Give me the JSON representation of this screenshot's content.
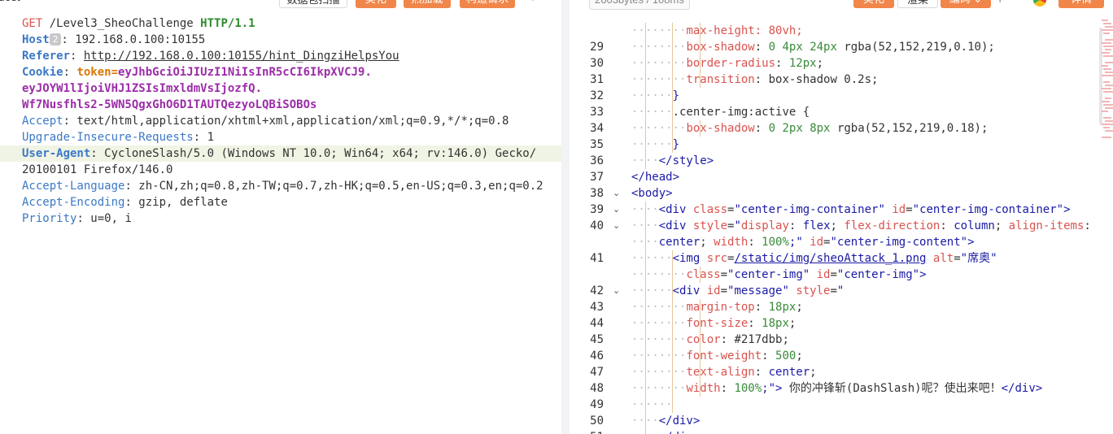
{
  "left": {
    "title": "uest",
    "nav_back": "‹",
    "nav_forward": "›",
    "buttons": [
      "数据包扫描",
      "美化",
      "热加载",
      "构造请求"
    ],
    "expand_icon": "expand-icon",
    "request_lines": [
      [
        {
          "t": "GET",
          "c": "k-method"
        },
        {
          "t": " /Level3_SheoChallenge ",
          "c": "k-path"
        },
        {
          "t": "HTTP/1.1",
          "c": "k-proto"
        }
      ],
      [
        {
          "t": "Host",
          "c": "k-hdr bold"
        },
        {
          "t": "2",
          "c": "badge"
        },
        {
          "t": ": 192.168.0.100:10155",
          "c": "k-val"
        }
      ],
      [
        {
          "t": "Referer",
          "c": "k-hdr bold"
        },
        {
          "t": ": ",
          "c": "k-val"
        },
        {
          "t": "http://192.168.0.100:10155/hint_DingziHelpsYou",
          "c": "k-link"
        }
      ],
      [
        {
          "t": "Cookie",
          "c": "k-hdr bold"
        },
        {
          "t": ": ",
          "c": "k-val"
        },
        {
          "t": "token=",
          "c": "k-token-name"
        },
        {
          "t": "eyJhbGciOiJIUzI1NiIsInR5cCI6IkpXVCJ9.",
          "c": "k-token"
        }
      ],
      [
        {
          "t": "eyJOYW1lIjoiVHJ1ZSIsImxldmVsIjozfQ.",
          "c": "k-token"
        }
      ],
      [
        {
          "t": "Wf7Nusfhls2-5WN5QgxGhO6D1TAUTQezyoLQBiSOBOs",
          "c": "k-token"
        }
      ],
      [
        {
          "t": "Accept",
          "c": "k-hdr"
        },
        {
          "t": ": text/html,application/xhtml+xml,application/xml;q=0.9,*/*;q=0.8",
          "c": "k-val"
        }
      ],
      [
        {
          "t": "Upgrade-Insecure-Requests",
          "c": "k-hdr"
        },
        {
          "t": ": 1",
          "c": "k-val"
        }
      ],
      [
        {
          "t": "User-Agent",
          "c": "k-hdr bold"
        },
        {
          "t": ": CycloneSlash/5.0 (Windows NT 10.0; Win64; x64; rv:146.0) Gecko/",
          "c": "k-val"
        }
      ],
      [
        {
          "t": "20100101 Firefox/146.0",
          "c": "k-val"
        }
      ],
      [
        {
          "t": "Accept-Language",
          "c": "k-hdr"
        },
        {
          "t": ": zh-CN,zh;q=0.8,zh-TW;q=0.7,zh-HK;q=0.5,en-US;q=0.3,en;q=0.2",
          "c": "k-val"
        }
      ],
      [
        {
          "t": "Accept-Encoding",
          "c": "k-hdr"
        },
        {
          "t": ": gzip, deflate",
          "c": "k-val"
        }
      ],
      [
        {
          "t": "Priority",
          "c": "k-hdr"
        },
        {
          "t": ": u=0, i",
          "c": "k-val"
        }
      ]
    ],
    "highlight_line": 8
  },
  "right": {
    "size_info": "2603bytes / 108ms",
    "buttons": [
      "美化",
      "渲染",
      "编码 ⌄",
      "详情"
    ],
    "search_icon": "search-icon",
    "code_lines": [
      {
        "n": "",
        "fold": "",
        "indent": 4,
        "tokens": [
          {
            "t": "max-height: 80vh;",
            "c": "c-prop"
          }
        ]
      },
      {
        "n": "29",
        "fold": "",
        "indent": 4,
        "tokens": [
          {
            "t": "box-shadow",
            "c": "c-prop"
          },
          {
            "t": ": ",
            "c": "c-txt"
          },
          {
            "t": "0",
            "c": "c-num"
          },
          {
            "t": " ",
            "c": "c-txt"
          },
          {
            "t": "4px",
            "c": "c-num"
          },
          {
            "t": " ",
            "c": "c-txt"
          },
          {
            "t": "24px",
            "c": "c-num"
          },
          {
            "t": " ",
            "c": "c-txt"
          },
          {
            "t": "rgba",
            "c": "c-txt"
          },
          {
            "t": "(52,152,219,0.10);",
            "c": "c-txt"
          }
        ]
      },
      {
        "n": "30",
        "fold": "",
        "indent": 4,
        "tokens": [
          {
            "t": "border-radius",
            "c": "c-prop"
          },
          {
            "t": ": ",
            "c": "c-txt"
          },
          {
            "t": "12px",
            "c": "c-num"
          },
          {
            "t": ";",
            "c": "c-txt"
          }
        ]
      },
      {
        "n": "31",
        "fold": "",
        "indent": 4,
        "tokens": [
          {
            "t": "transition",
            "c": "c-prop"
          },
          {
            "t": ": box-shadow 0.2s;",
            "c": "c-txt"
          }
        ]
      },
      {
        "n": "32",
        "fold": "",
        "indent": 3,
        "tokens": [
          {
            "t": "}",
            "c": "c-tag"
          }
        ]
      },
      {
        "n": "33",
        "fold": "",
        "indent": 3,
        "tokens": [
          {
            "t": ".center-img:active {",
            "c": "c-txt"
          }
        ]
      },
      {
        "n": "34",
        "fold": "",
        "indent": 4,
        "tokens": [
          {
            "t": "box-shadow",
            "c": "c-prop"
          },
          {
            "t": ": ",
            "c": "c-txt"
          },
          {
            "t": "0",
            "c": "c-num"
          },
          {
            "t": " ",
            "c": "c-txt"
          },
          {
            "t": "2px",
            "c": "c-num"
          },
          {
            "t": " ",
            "c": "c-txt"
          },
          {
            "t": "8px",
            "c": "c-num"
          },
          {
            "t": " ",
            "c": "c-txt"
          },
          {
            "t": "rgba",
            "c": "c-txt"
          },
          {
            "t": "(52,152,219,0.18);",
            "c": "c-txt"
          }
        ]
      },
      {
        "n": "35",
        "fold": "",
        "indent": 3,
        "tokens": [
          {
            "t": "}",
            "c": "c-tag"
          }
        ]
      },
      {
        "n": "36",
        "fold": "",
        "indent": 2,
        "tokens": [
          {
            "t": "</style>",
            "c": "c-tag"
          }
        ]
      },
      {
        "n": "37",
        "fold": "",
        "indent": 0,
        "tokens": [
          {
            "t": "</head>",
            "c": "c-tag"
          }
        ]
      },
      {
        "n": "38",
        "fold": "⌄",
        "indent": 0,
        "tokens": [
          {
            "t": "<body>",
            "c": "c-tag"
          }
        ]
      },
      {
        "n": "39",
        "fold": "⌄",
        "indent": 2,
        "tokens": [
          {
            "t": "<div ",
            "c": "c-tag"
          },
          {
            "t": "class",
            "c": "c-attr"
          },
          {
            "t": "=",
            "c": "c-txt"
          },
          {
            "t": "\"center-img-container\"",
            "c": "c-str"
          },
          {
            "t": " ",
            "c": "c-txt"
          },
          {
            "t": "id",
            "c": "c-attr"
          },
          {
            "t": "=",
            "c": "c-txt"
          },
          {
            "t": "\"center-img-container\"",
            "c": "c-str"
          },
          {
            "t": ">",
            "c": "c-tag"
          }
        ]
      },
      {
        "n": "40",
        "fold": "⌄",
        "indent": 2,
        "tokens": [
          {
            "t": "<div ",
            "c": "c-tag"
          },
          {
            "t": "style",
            "c": "c-attr"
          },
          {
            "t": "=",
            "c": "c-txt"
          },
          {
            "t": "\"",
            "c": "c-str"
          },
          {
            "t": "display",
            "c": "c-prop"
          },
          {
            "t": ": ",
            "c": "c-txt"
          },
          {
            "t": "flex",
            "c": "c-str"
          },
          {
            "t": "; ",
            "c": "c-txt"
          },
          {
            "t": "flex-direction",
            "c": "c-prop"
          },
          {
            "t": ": ",
            "c": "c-txt"
          },
          {
            "t": "column",
            "c": "c-str"
          },
          {
            "t": "; ",
            "c": "c-txt"
          },
          {
            "t": "align-items",
            "c": "c-prop"
          },
          {
            "t": ":",
            "c": "c-txt"
          }
        ]
      },
      {
        "n": "",
        "fold": "",
        "indent": 2,
        "tokens": [
          {
            "t": "center",
            "c": "c-str"
          },
          {
            "t": "; ",
            "c": "c-txt"
          },
          {
            "t": "width",
            "c": "c-prop"
          },
          {
            "t": ": ",
            "c": "c-txt"
          },
          {
            "t": "100%",
            "c": "c-num"
          },
          {
            "t": ";\"",
            "c": "c-str"
          },
          {
            "t": " ",
            "c": "c-txt"
          },
          {
            "t": "id",
            "c": "c-attr"
          },
          {
            "t": "=",
            "c": "c-txt"
          },
          {
            "t": "\"center-img-content\"",
            "c": "c-str"
          },
          {
            "t": ">",
            "c": "c-tag"
          }
        ]
      },
      {
        "n": "41",
        "fold": "",
        "indent": 3,
        "tokens": [
          {
            "t": "<img ",
            "c": "c-tag"
          },
          {
            "t": "src",
            "c": "c-attr"
          },
          {
            "t": "=",
            "c": "c-txt"
          },
          {
            "t": "/static/img/sheoAttack_1.png",
            "c": "c-link"
          },
          {
            "t": " ",
            "c": "c-txt"
          },
          {
            "t": "alt",
            "c": "c-attr"
          },
          {
            "t": "=",
            "c": "c-txt"
          },
          {
            "t": "\"席奥\"",
            "c": "c-str"
          }
        ]
      },
      {
        "n": "",
        "fold": "",
        "indent": 4,
        "tokens": [
          {
            "t": "class",
            "c": "c-attr"
          },
          {
            "t": "=",
            "c": "c-txt"
          },
          {
            "t": "\"center-img\"",
            "c": "c-str"
          },
          {
            "t": " ",
            "c": "c-txt"
          },
          {
            "t": "id",
            "c": "c-attr"
          },
          {
            "t": "=",
            "c": "c-txt"
          },
          {
            "t": "\"center-img\"",
            "c": "c-str"
          },
          {
            "t": ">",
            "c": "c-tag"
          }
        ]
      },
      {
        "n": "42",
        "fold": "⌄",
        "indent": 3,
        "tokens": [
          {
            "t": "<div ",
            "c": "c-tag"
          },
          {
            "t": "id",
            "c": "c-attr"
          },
          {
            "t": "=",
            "c": "c-txt"
          },
          {
            "t": "\"message\"",
            "c": "c-str"
          },
          {
            "t": " ",
            "c": "c-txt"
          },
          {
            "t": "style",
            "c": "c-attr"
          },
          {
            "t": "=",
            "c": "c-txt"
          },
          {
            "t": "\"",
            "c": "c-str"
          }
        ]
      },
      {
        "n": "43",
        "fold": "",
        "indent": 4,
        "tokens": [
          {
            "t": "margin-top",
            "c": "c-prop"
          },
          {
            "t": ": ",
            "c": "c-txt"
          },
          {
            "t": "18px",
            "c": "c-num"
          },
          {
            "t": ";",
            "c": "c-txt"
          }
        ]
      },
      {
        "n": "44",
        "fold": "",
        "indent": 4,
        "tokens": [
          {
            "t": "font-size",
            "c": "c-prop"
          },
          {
            "t": ": ",
            "c": "c-txt"
          },
          {
            "t": "18px",
            "c": "c-num"
          },
          {
            "t": ";",
            "c": "c-txt"
          }
        ]
      },
      {
        "n": "45",
        "fold": "",
        "indent": 4,
        "tokens": [
          {
            "t": "color",
            "c": "c-prop"
          },
          {
            "t": ": #217dbb;",
            "c": "c-txt"
          }
        ]
      },
      {
        "n": "46",
        "fold": "",
        "indent": 4,
        "tokens": [
          {
            "t": "font-weight",
            "c": "c-prop"
          },
          {
            "t": ": ",
            "c": "c-txt"
          },
          {
            "t": "500",
            "c": "c-num"
          },
          {
            "t": ";",
            "c": "c-txt"
          }
        ]
      },
      {
        "n": "47",
        "fold": "",
        "indent": 4,
        "tokens": [
          {
            "t": "text-align",
            "c": "c-prop"
          },
          {
            "t": ": ",
            "c": "c-txt"
          },
          {
            "t": "center",
            "c": "c-str"
          },
          {
            "t": ";",
            "c": "c-txt"
          }
        ]
      },
      {
        "n": "48",
        "fold": "",
        "indent": 4,
        "tokens": [
          {
            "t": "width",
            "c": "c-prop"
          },
          {
            "t": ": ",
            "c": "c-txt"
          },
          {
            "t": "100%",
            "c": "c-num"
          },
          {
            "t": ";\"",
            "c": "c-str"
          },
          {
            "t": ">",
            "c": "c-tag"
          },
          {
            "t": " 你的冲锋斩(DashSlash)呢？使出来吧！",
            "c": "c-txt"
          },
          {
            "t": "</div>",
            "c": "c-tag"
          }
        ]
      },
      {
        "n": "49",
        "fold": "",
        "indent": 3,
        "tokens": []
      },
      {
        "n": "50",
        "fold": "",
        "indent": 2,
        "tokens": [
          {
            "t": "</div>",
            "c": "c-tag"
          }
        ]
      },
      {
        "n": "51",
        "fold": "",
        "indent": 2,
        "tokens": [
          {
            "t": "</div>",
            "c": "c-tag"
          }
        ]
      }
    ]
  },
  "colors": {
    "accent_orange": "#f1864a",
    "highlight_row": "#f0f4e4",
    "indent_guide": "#e4c89a"
  }
}
